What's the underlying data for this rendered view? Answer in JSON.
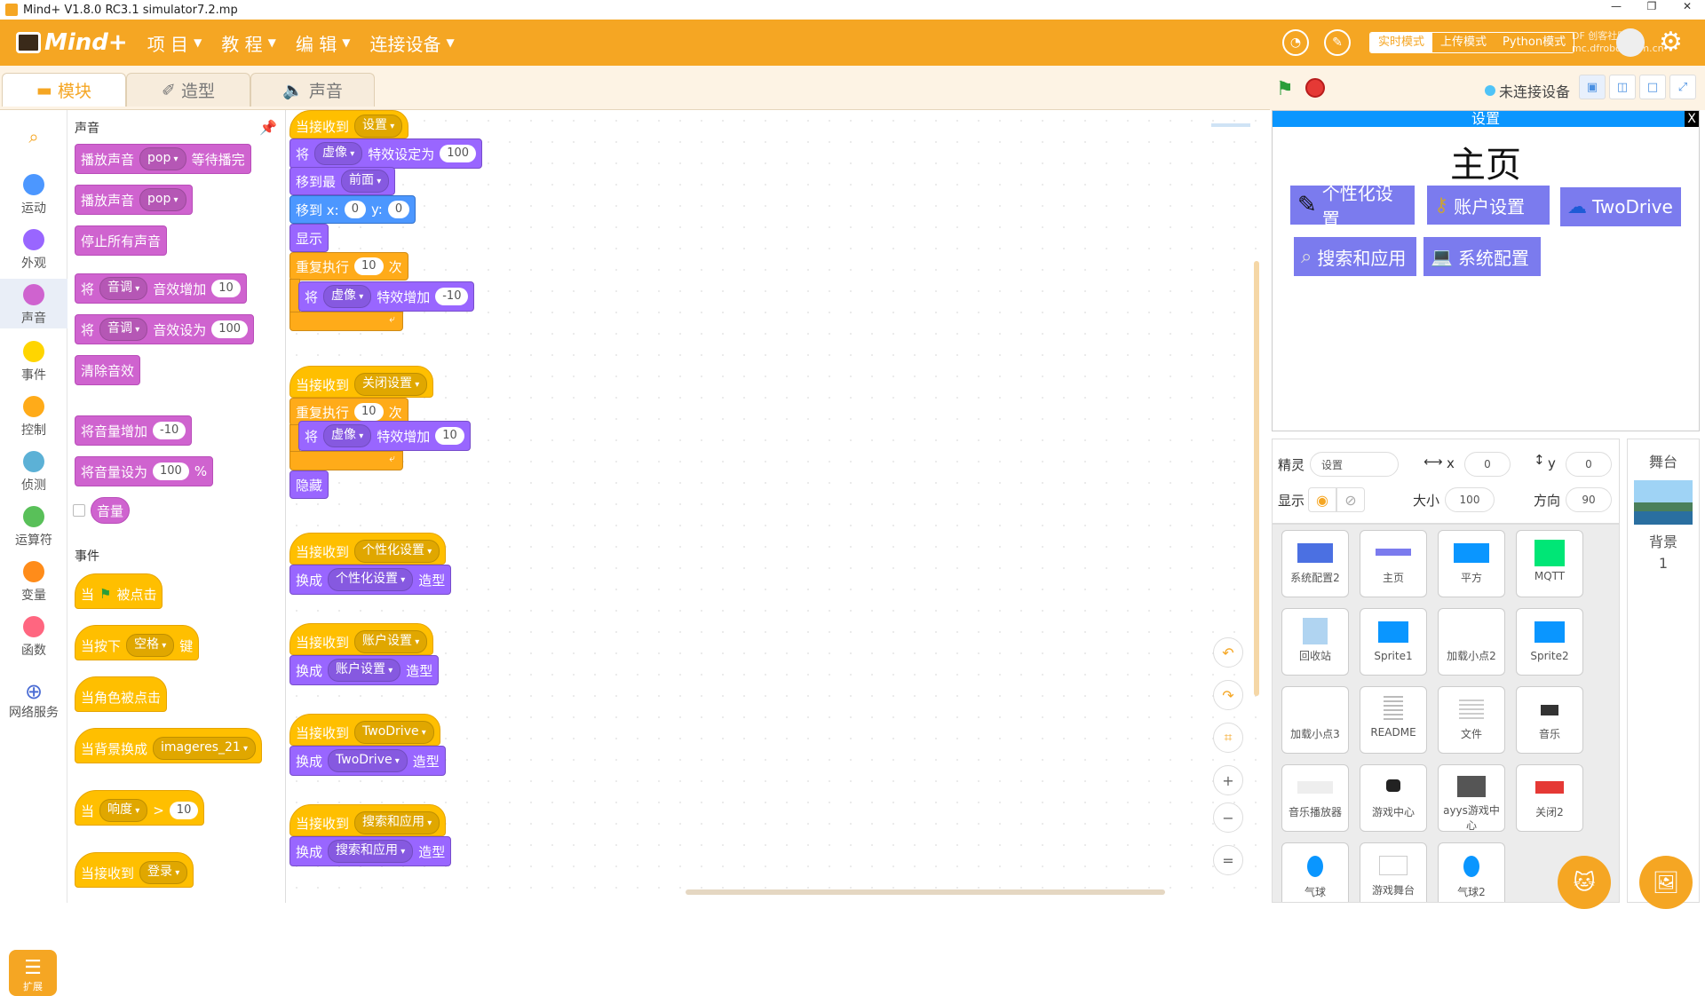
{
  "window": {
    "title": "Mind+ V1.8.0 RC3.1   simulator7.2.mp",
    "controls": [
      "—",
      "❐",
      "✕"
    ]
  },
  "menubar": {
    "logo": "Mind+",
    "items": [
      "项 目",
      "教 程",
      "编 辑",
      "连接设备"
    ],
    "modes": [
      "实时模式",
      "上传模式",
      "Python模式"
    ],
    "active_mode": "实时模式",
    "watermark": "DF 创客社区 mc.dfrobot.com.cn"
  },
  "tabs": [
    "模块",
    "造型",
    "声音"
  ],
  "stage_toolbar": {
    "connection": "未连接设备"
  },
  "categories": [
    "运动",
    "外观",
    "声音",
    "事件",
    "控制",
    "侦测",
    "运算符",
    "变量",
    "函数",
    "网络服务"
  ],
  "category_colors": [
    "#4c97ff",
    "#9966ff",
    "#cf63cf",
    "#ffd500",
    "#ffab19",
    "#5cb1d6",
    "#59c059",
    "#ff8c1a",
    "#ff6680",
    "#4a6cd4"
  ],
  "extension_label": "扩展",
  "palette": {
    "section_sound": "声音",
    "play_until_done": {
      "a": "播放声音",
      "dd": "pop",
      "b": "等待播完"
    },
    "play": {
      "a": "播放声音",
      "dd": "pop"
    },
    "stop_all": "停止所有声音",
    "change_effect": {
      "a": "将",
      "dd": "音调",
      "b": "音效增加",
      "v": "10"
    },
    "set_effect": {
      "a": "将",
      "dd": "音调",
      "b": "音效设为",
      "v": "100"
    },
    "clear": "清除音效",
    "change_volume": {
      "a": "将音量增加",
      "v": "-10"
    },
    "set_volume": {
      "a": "将音量设为",
      "v": "100",
      "b": "%"
    },
    "volume": "音量",
    "section_events": "事件",
    "when_flag": {
      "a": "当",
      "b": "被点击"
    },
    "when_key": {
      "a": "当按下",
      "dd": "空格",
      "b": "键"
    },
    "when_sprite": "当角色被点击",
    "when_backdrop": {
      "a": "当背景换成",
      "dd": "imageres_21"
    },
    "when_gt": {
      "a": "当",
      "dd": "响度",
      "op": ">",
      "v": "10"
    },
    "when_receive": {
      "a": "当接收到",
      "dd": "登录"
    }
  },
  "scripts": {
    "s1": {
      "hat": "当接收到",
      "msg": "设置",
      "set_a": "将",
      "set_dd": "虚像",
      "set_b": "特效设定为",
      "set_v": "100",
      "front_a": "移到最",
      "front_dd": "前面",
      "goto_a": "移到 x:",
      "goto_x": "0",
      "goto_b": "y:",
      "goto_y": "0",
      "show": "显示",
      "rep_a": "重复执行",
      "rep_v": "10",
      "rep_b": "次",
      "inner_a": "将",
      "inner_dd": "虚像",
      "inner_b": "特效增加",
      "inner_v": "-10"
    },
    "s2": {
      "hat": "当接收到",
      "msg": "关闭设置",
      "rep_a": "重复执行",
      "rep_v": "10",
      "rep_b": "次",
      "inner_a": "将",
      "inner_dd": "虚像",
      "inner_b": "特效增加",
      "inner_v": "10",
      "hide": "隐藏"
    },
    "s3": {
      "hat": "当接收到",
      "msg": "个性化设置",
      "sw_a": "换成",
      "sw_dd": "个性化设置",
      "sw_b": "造型"
    },
    "s4": {
      "hat": "当接收到",
      "msg": "账户设置",
      "sw_a": "换成",
      "sw_dd": "账户设置",
      "sw_b": "造型"
    },
    "s5": {
      "hat": "当接收到",
      "msg": "TwoDrive",
      "sw_a": "换成",
      "sw_dd": "TwoDrive",
      "sw_b": "造型"
    },
    "s6": {
      "hat": "当接收到",
      "msg": "搜索和应用",
      "sw_a": "换成",
      "sw_dd": "搜索和应用",
      "sw_b": "造型"
    }
  },
  "stage": {
    "header": "设置",
    "close": "X",
    "title": "主页",
    "buttons": [
      "个性化设置",
      "账户设置",
      "TwoDrive",
      "搜索和应用",
      "系统配置"
    ]
  },
  "sprite_info": {
    "sprite_label": "精灵",
    "sprite_name": "设置",
    "x_label": "x",
    "x": "0",
    "y_label": "y",
    "y": "0",
    "show_label": "显示",
    "size_label": "大小",
    "size": "100",
    "dir_label": "方向",
    "direction": "90"
  },
  "sprites": [
    "系统配置2",
    "主页",
    "平方",
    "MQTT",
    "回收站",
    "Sprite1",
    "加载小点2",
    "Sprite2",
    "加载小点3",
    "README",
    "文件",
    "音乐",
    "音乐播放器",
    "游戏中心",
    "ayys游戏中心",
    "关闭2",
    "气球",
    "游戏舞台",
    "气球2"
  ],
  "stage_pane": {
    "title": "舞台",
    "bg_label": "背景",
    "bg_count": "1"
  }
}
